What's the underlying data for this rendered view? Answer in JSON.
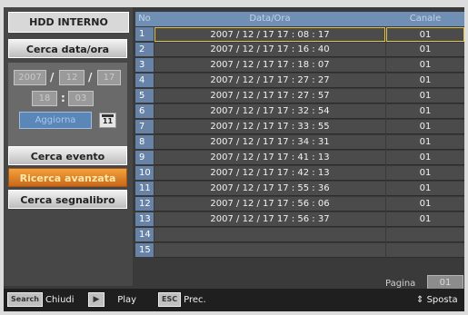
{
  "left_panel": {
    "title": "HDD INTERNO",
    "search_date_button": "Cerca data/ora",
    "date": {
      "year": "2007",
      "month": "12",
      "day": "17",
      "hour": "18",
      "minute": "03",
      "separator_slash": "/",
      "separator_colon": ":"
    },
    "refresh_button": "Aggiorna",
    "calendar_day": "11",
    "search_event_button": "Cerca evento",
    "advanced_search_button": "Ricerca avanzata",
    "bookmark_search_button": "Cerca segnalibro"
  },
  "table": {
    "headers": {
      "no": "No",
      "datetime": "Data/Ora",
      "channel": "Canale"
    },
    "rows": [
      {
        "no": "1",
        "datetime": "2007 / 12 / 17    17 : 08 : 17",
        "channel": "01"
      },
      {
        "no": "2",
        "datetime": "2007 / 12 / 17    17 : 16 : 40",
        "channel": "01"
      },
      {
        "no": "3",
        "datetime": "2007 / 12 / 17    17 : 18 : 07",
        "channel": "01"
      },
      {
        "no": "4",
        "datetime": "2007 / 12 / 17    17 : 27 : 27",
        "channel": "01"
      },
      {
        "no": "5",
        "datetime": "2007 / 12 / 17    17 : 27 : 57",
        "channel": "01"
      },
      {
        "no": "6",
        "datetime": "2007 / 12 / 17    17 : 32 : 54",
        "channel": "01"
      },
      {
        "no": "7",
        "datetime": "2007 / 12 / 17    17 : 33 : 55",
        "channel": "01"
      },
      {
        "no": "8",
        "datetime": "2007 / 12 / 17    17 : 34 : 31",
        "channel": "01"
      },
      {
        "no": "9",
        "datetime": "2007 / 12 / 17    17 : 41 : 13",
        "channel": "01"
      },
      {
        "no": "10",
        "datetime": "2007 / 12 / 17    17 : 42 : 13",
        "channel": "01"
      },
      {
        "no": "11",
        "datetime": "2007 / 12 / 17    17 : 55 : 36",
        "channel": "01"
      },
      {
        "no": "12",
        "datetime": "2007 / 12 / 17    17 : 56 : 06",
        "channel": "01"
      },
      {
        "no": "13",
        "datetime": "2007 / 12 / 17    17 : 56 : 37",
        "channel": "01"
      },
      {
        "no": "14",
        "datetime": "",
        "channel": ""
      },
      {
        "no": "15",
        "datetime": "",
        "channel": ""
      }
    ],
    "selected_row": 1
  },
  "pagination": {
    "label": "Pagina",
    "value": "01"
  },
  "bottom_bar": {
    "search_key": "Search",
    "close_label": "Chiudi",
    "play_key": "▶",
    "play_label": "Play",
    "esc_key": "ESC",
    "prev_label": "Prec.",
    "move_icon": "⇕",
    "move_label": "Sposta"
  },
  "colors": {
    "accent_orange": "#e08a2c",
    "header_blue": "#6f8fb5",
    "selection": "#e1c24a"
  }
}
